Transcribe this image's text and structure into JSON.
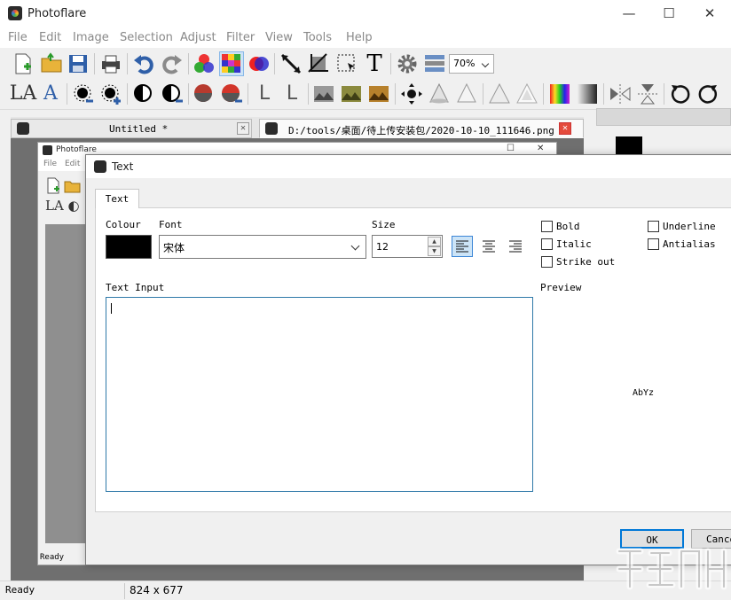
{
  "app": {
    "title": "Photoflare"
  },
  "window_controls": {
    "minimize": "—",
    "maximize": "☐",
    "close": "✕"
  },
  "menu": [
    "File",
    "Edit",
    "Image",
    "Selection",
    "Adjust",
    "Filter",
    "View",
    "Tools",
    "Help"
  ],
  "toolbar": {
    "zoom": "70%"
  },
  "tabs": [
    {
      "label": "Untitled *",
      "close": "✕"
    },
    {
      "label": "D:/tools/桌面/待上传安装包/2020-10-10_111646.png *",
      "close": "✕"
    }
  ],
  "inner_window": {
    "title": "Photoflare",
    "menu": [
      "File",
      "Edit"
    ],
    "status": "Ready",
    "controls": {
      "maximize": "☐",
      "close": "✕"
    }
  },
  "dialog": {
    "title": "Text",
    "tab": "Text",
    "colour_label": "Colour",
    "colour": "#000000",
    "font_label": "Font",
    "font_value": "宋体",
    "size_label": "Size",
    "size_value": "12",
    "spin_up": "▲",
    "spin_down": "▼",
    "checks": [
      {
        "label": "Bold",
        "checked": false
      },
      {
        "label": "Italic",
        "checked": false
      },
      {
        "label": "Strike out",
        "checked": false
      },
      {
        "label": "Underline",
        "checked": false
      },
      {
        "label": "Antialias",
        "checked": false
      }
    ],
    "text_input_label": "Text Input",
    "preview_label": "Preview",
    "preview_text": "AbYz",
    "ok": "OK",
    "cancel": "Cancel"
  },
  "status": {
    "state": "Ready",
    "dimensions": "824 x 677"
  },
  "icons": [
    "new-file-icon",
    "open-folder-icon",
    "save-icon",
    "print-icon",
    "undo-icon",
    "redo-icon",
    "rgb-circles-icon",
    "mosaic-icon",
    "color-blend-icon",
    "line-tool-icon",
    "crop-icon",
    "select-icon",
    "text-tool-icon",
    "gear-icon",
    "layers-icon"
  ]
}
